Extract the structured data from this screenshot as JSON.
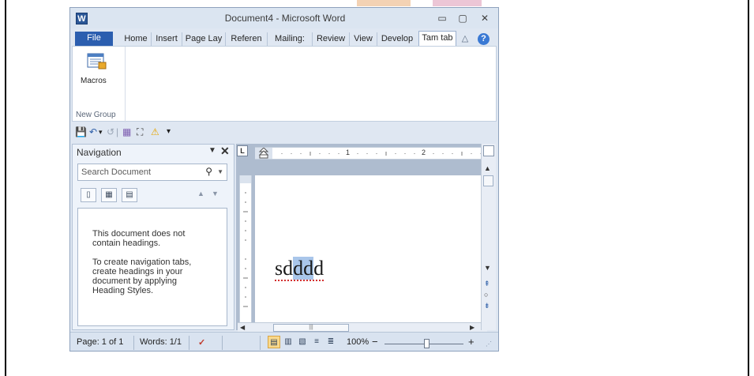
{
  "window": {
    "title": "Document4  -  Microsoft Word",
    "app_icon_letter": "W",
    "controls": {
      "minimize": "▭",
      "restore": "▢",
      "close": "✕"
    }
  },
  "tabs": [
    {
      "label": "File"
    },
    {
      "label": "Home"
    },
    {
      "label": "Insert"
    },
    {
      "label": "Page Lay"
    },
    {
      "label": "Referen"
    },
    {
      "label": "Mailing:"
    },
    {
      "label": "Review"
    },
    {
      "label": "View"
    },
    {
      "label": "Develop"
    },
    {
      "label": "Tam tab"
    }
  ],
  "ribbon": {
    "minimize_caret": "△",
    "help": "?",
    "macros_label": "Macros",
    "group_label": "New Group"
  },
  "qat": {
    "save": "💾",
    "undo": "↶",
    "dropdown1": "▾",
    "redo": "↺",
    "table": "▦",
    "network": "⛶",
    "warning": "⚠",
    "customize": "▾"
  },
  "navigation": {
    "title": "Navigation",
    "dropdown": "▼",
    "close": "✕",
    "search_placeholder": "Search Document",
    "search_icon": "⚲",
    "search_drop": "▼",
    "tab_icons": [
      "▯",
      "▦",
      "▤"
    ],
    "up_arrow": "▲",
    "down_arrow": "▼",
    "msg1": "This document does not\ncontain headings.",
    "msg2": "To create navigation tabs,\ncreate headings in your\ndocument by applying\nHeading Styles."
  },
  "ruler": {
    "tab_button": "L",
    "label1": "1",
    "label2": "2"
  },
  "document": {
    "text_before": "sd",
    "text_selected": "dd",
    "text_after": "d"
  },
  "scroll": {
    "up": "▲",
    "down": "▼",
    "prev_page": "⇞",
    "select_browse": "○",
    "next_page": "⇟",
    "left": "◀",
    "right": "▶",
    "thumb": "|||"
  },
  "status": {
    "page": "Page: 1 of 1",
    "words": "Words: 1/1",
    "proofing_icon": "✓",
    "zoom": "100%",
    "zoom_out": "−",
    "zoom_in": "+",
    "zoom_level": 1.0
  }
}
